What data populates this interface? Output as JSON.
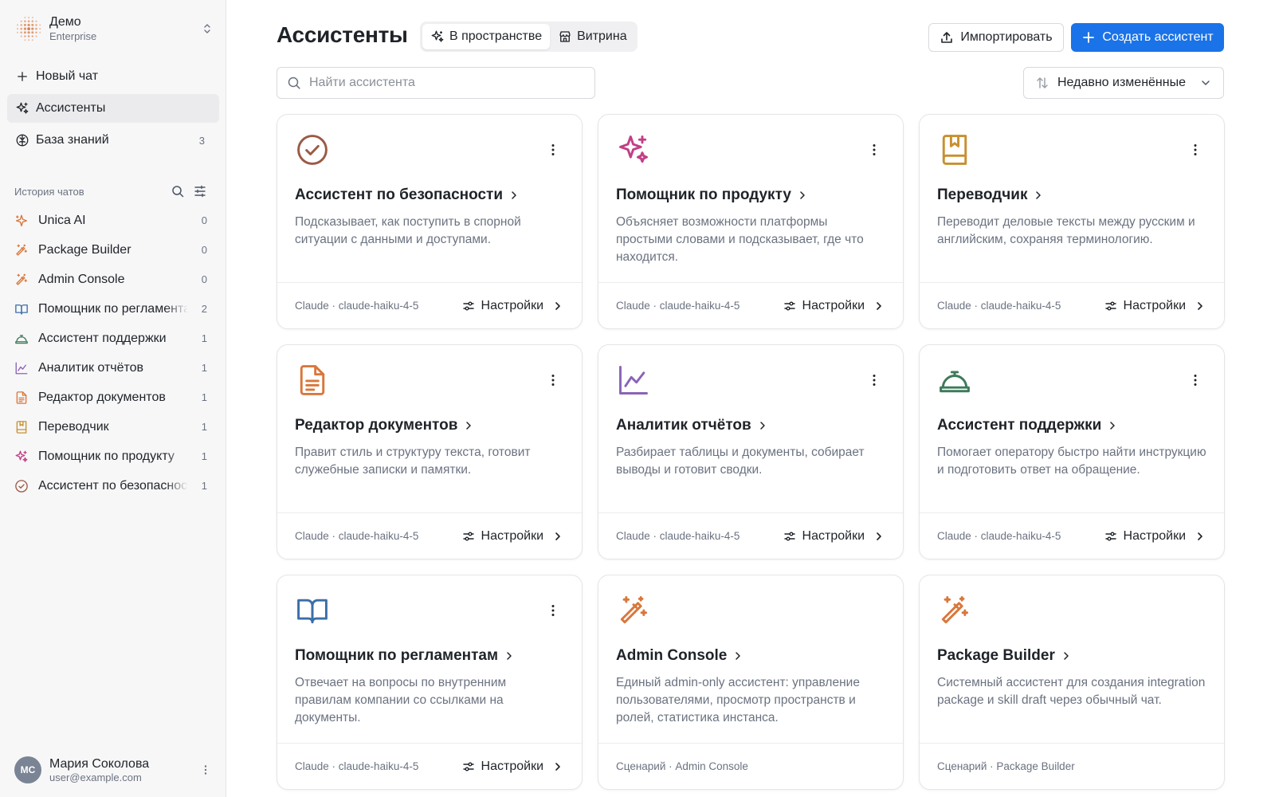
{
  "workspace": {
    "name": "Демо",
    "plan": "Enterprise"
  },
  "nav": [
    {
      "label": "Новый чат",
      "icon": "plus-icon",
      "count": ""
    },
    {
      "label": "Ассистенты",
      "icon": "sparkles-icon",
      "count": "",
      "active": true
    },
    {
      "label": "База знаний",
      "icon": "brain-icon",
      "count": "3"
    }
  ],
  "history": {
    "title": "История чатов",
    "items": [
      {
        "label": "Unica AI",
        "count": "0",
        "icon": "sparkle-icon",
        "color": "#d9773b"
      },
      {
        "label": "Package Builder",
        "count": "0",
        "icon": "magic-wand-icon",
        "color": "#d9773b"
      },
      {
        "label": "Admin Console",
        "count": "0",
        "icon": "magic-wand-icon",
        "color": "#d9773b"
      },
      {
        "label": "Помощник по регламентам",
        "count": "2",
        "icon": "book-open-icon",
        "color": "#3b6ea8"
      },
      {
        "label": "Ассистент поддержки",
        "count": "1",
        "icon": "service-bell-icon",
        "color": "#3e7a5a"
      },
      {
        "label": "Аналитик отчётов",
        "count": "1",
        "icon": "line-chart-icon",
        "color": "#8a63b8"
      },
      {
        "label": "Редактор документов",
        "count": "1",
        "icon": "document-icon",
        "color": "#d9773b"
      },
      {
        "label": "Переводчик",
        "count": "1",
        "icon": "bookmark-book-icon",
        "color": "#c8902f"
      },
      {
        "label": "Помощник по продукту",
        "count": "1",
        "icon": "sparkles-icon",
        "color": "#c23f86"
      },
      {
        "label": "Ассистент по безопасности",
        "count": "1",
        "icon": "check-circle-icon",
        "color": "#9b5a44"
      }
    ]
  },
  "user": {
    "initials": "МС",
    "name": "Мария Соколова",
    "email": "user@example.com"
  },
  "header": {
    "title": "Ассистенты",
    "tabs": [
      {
        "label": "В пространстве",
        "icon": "sparkles-icon",
        "active": true
      },
      {
        "label": "Витрина",
        "icon": "store-icon",
        "active": false
      }
    ],
    "import_label": "Импортировать",
    "create_label": "Создать ассистент",
    "accent": "#1a73e8"
  },
  "search": {
    "placeholder": "Найти ассистента",
    "value": ""
  },
  "sort": {
    "label": "Недавно изменённые"
  },
  "settings_label": "Настройки",
  "cards": [
    {
      "title": "Ассистент по безопасности",
      "desc": "Подсказывает, как поступить в спорной ситуации с данными и доступами.",
      "model": "Claude · claude-haiku-4-5",
      "icon": "check-circle-icon",
      "color": "#9b5a44",
      "has_settings": true,
      "has_menu": true
    },
    {
      "title": "Помощник по продукту",
      "desc": "Объясняет возможности платформы простыми словами и подсказывает, где что находится.",
      "model": "Claude · claude-haiku-4-5",
      "icon": "sparkles-icon",
      "color": "#c23f86",
      "has_settings": true,
      "has_menu": true
    },
    {
      "title": "Переводчик",
      "desc": "Переводит деловые тексты между русским и английским, сохраняя терминологию.",
      "model": "Claude · claude-haiku-4-5",
      "icon": "bookmark-book-icon",
      "color": "#c8902f",
      "has_settings": true,
      "has_menu": true
    },
    {
      "title": "Редактор документов",
      "desc": "Правит стиль и структуру текста, готовит служебные записки и памятки.",
      "model": "Claude · claude-haiku-4-5",
      "icon": "document-icon",
      "color": "#d9773b",
      "has_settings": true,
      "has_menu": true
    },
    {
      "title": "Аналитик отчётов",
      "desc": "Разбирает таблицы и документы, собирает выводы и готовит сводки.",
      "model": "Claude · claude-haiku-4-5",
      "icon": "line-chart-icon",
      "color": "#8a63b8",
      "has_settings": true,
      "has_menu": true
    },
    {
      "title": "Ассистент поддержки",
      "desc": "Помогает оператору быстро найти инструкцию и подготовить ответ на обращение.",
      "model": "Claude · claude-haiku-4-5",
      "icon": "service-bell-icon",
      "color": "#3e7a5a",
      "has_settings": true,
      "has_menu": true
    },
    {
      "title": "Помощник по регламентам",
      "desc": "Отвечает на вопросы по внутренним правилам компании со ссылками на документы.",
      "model": "Claude · claude-haiku-4-5",
      "icon": "book-open-icon",
      "color": "#3b6ea8",
      "has_settings": true,
      "has_menu": true
    },
    {
      "title": "Admin Console",
      "desc": "Единый admin-only ассистент: управление пользователями, просмотр пространств и ролей, статистика инстанса.",
      "model": "Сценарий · Admin Console",
      "icon": "magic-wand-icon",
      "color": "#d9773b",
      "has_settings": false,
      "has_menu": false
    },
    {
      "title": "Package Builder",
      "desc": "Системный ассистент для создания integration package и skill draft через обычный чат.",
      "model": "Сценарий · Package Builder",
      "icon": "magic-wand-icon",
      "color": "#d9773b",
      "has_settings": false,
      "has_menu": false
    }
  ]
}
